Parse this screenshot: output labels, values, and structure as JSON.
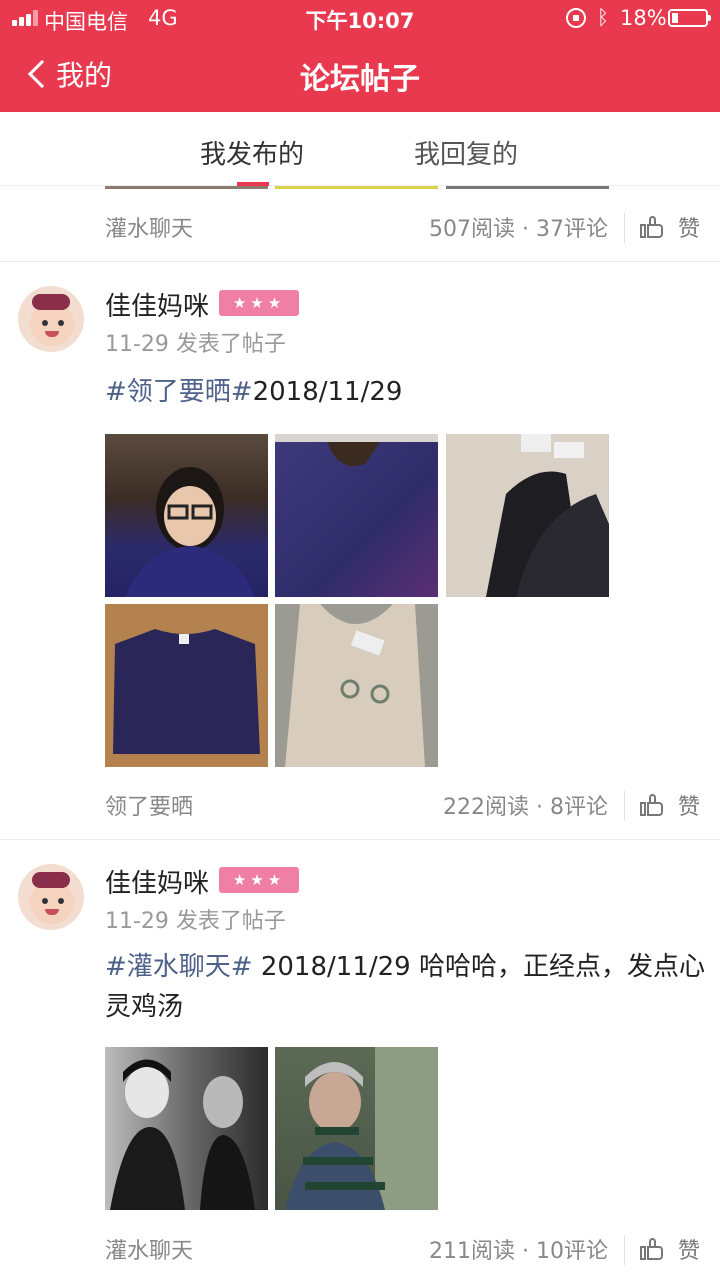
{
  "status_bar": {
    "carrier": "中国电信",
    "network": "4G",
    "time": "下午10:07",
    "battery_percent": "18%"
  },
  "nav": {
    "back_label": "我的",
    "title": "论坛帖子"
  },
  "tabs": [
    {
      "label": "我发布的",
      "active": true
    },
    {
      "label": "我回复的",
      "active": false
    }
  ],
  "colors": {
    "brand": "#e8394f",
    "hashtag": "#4e6189",
    "badge": "#ef7fa5"
  },
  "first_post_footer": {
    "category": "灌水聊天",
    "stats": "507阅读 · 37评论",
    "like_label": "赞"
  },
  "posts": [
    {
      "author": "佳佳妈咪",
      "badge": "★★★",
      "time": "11-29 发表了帖子",
      "hashtag": "#领了要晒#",
      "text": "2018/11/29",
      "images": [
        "selfie-photo",
        "sweater-photo",
        "pants-photo",
        "sweater-flat-photo",
        "slip-dress-photo"
      ],
      "category": "领了要晒",
      "stats": "222阅读 · 8评论",
      "like_label": "赞"
    },
    {
      "author": "佳佳妈咪",
      "badge": "★★★",
      "time": "11-29 发表了帖子",
      "hashtag": "#灌水聊天#",
      "text": " 2018/11/29  哈哈哈，正经点，发点心灵鸡汤",
      "images": [
        "vintage-portrait-photo",
        "elderly-woman-photo"
      ],
      "category": "灌水聊天",
      "stats": "211阅读 · 10评论",
      "like_label": "赞"
    }
  ]
}
